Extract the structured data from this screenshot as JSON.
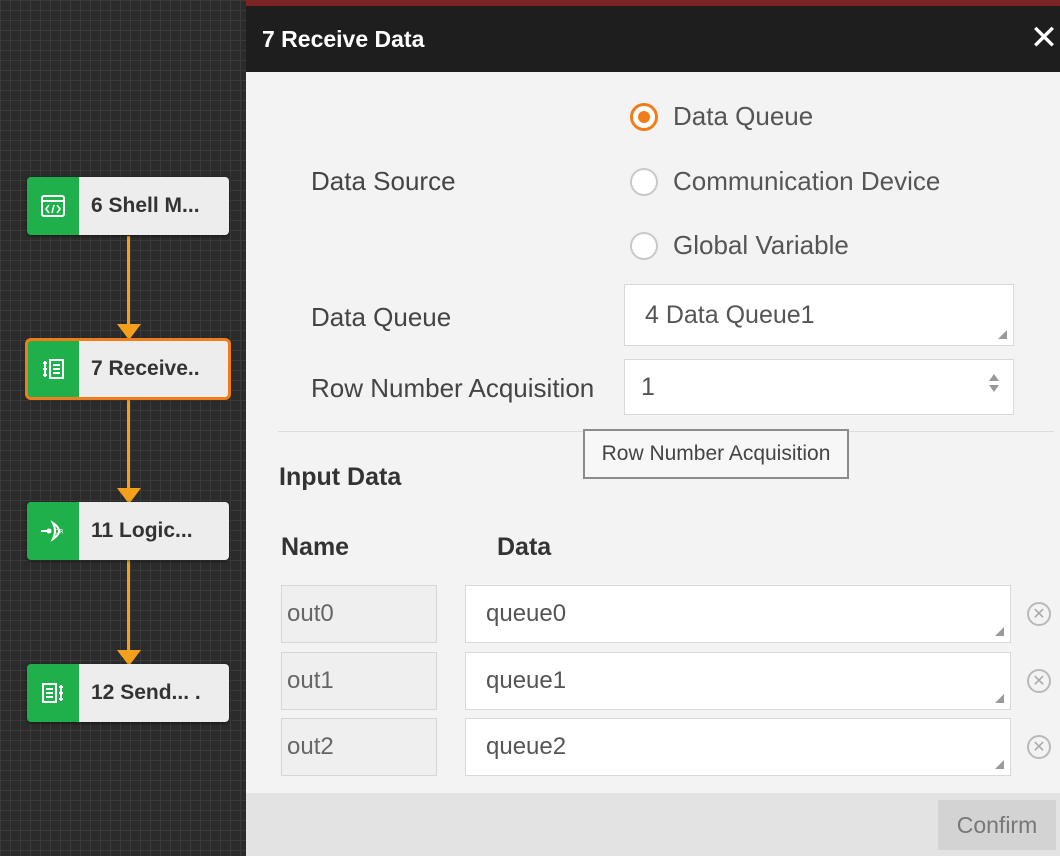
{
  "flow": {
    "nodes": [
      {
        "label": "6 Shell M...",
        "icon": "code-window-icon"
      },
      {
        "label": "7 Receive..",
        "icon": "receive-data-icon",
        "selected": true
      },
      {
        "label": "11 Logic...",
        "icon": "logic-or-icon"
      },
      {
        "label": "12 Send... .",
        "icon": "send-data-icon"
      }
    ],
    "connector_color": "#f4a01c",
    "node_icon_bg": "#20b04b",
    "selected_border": "#f07d1a"
  },
  "dialog": {
    "title": "7 Receive Data",
    "close_icon": "close-icon",
    "data_source": {
      "label": "Data Source",
      "options": [
        "Data Queue",
        "Communication Device",
        "Global Variable"
      ],
      "selected": "Data Queue"
    },
    "data_queue": {
      "label": "Data Queue",
      "value": "4 Data Queue1"
    },
    "row_number": {
      "label": "Row Number Acquisition",
      "value": "1"
    },
    "tooltip": "Row Number Acquisition",
    "input_data": {
      "heading": "Input Data",
      "col_name": "Name",
      "col_data": "Data",
      "rows": [
        {
          "name": "out0",
          "data": "queue0"
        },
        {
          "name": "out1",
          "data": "queue1"
        },
        {
          "name": "out2",
          "data": "queue2"
        }
      ]
    },
    "confirm_label": "Confirm",
    "accent": "#f07d1a"
  }
}
